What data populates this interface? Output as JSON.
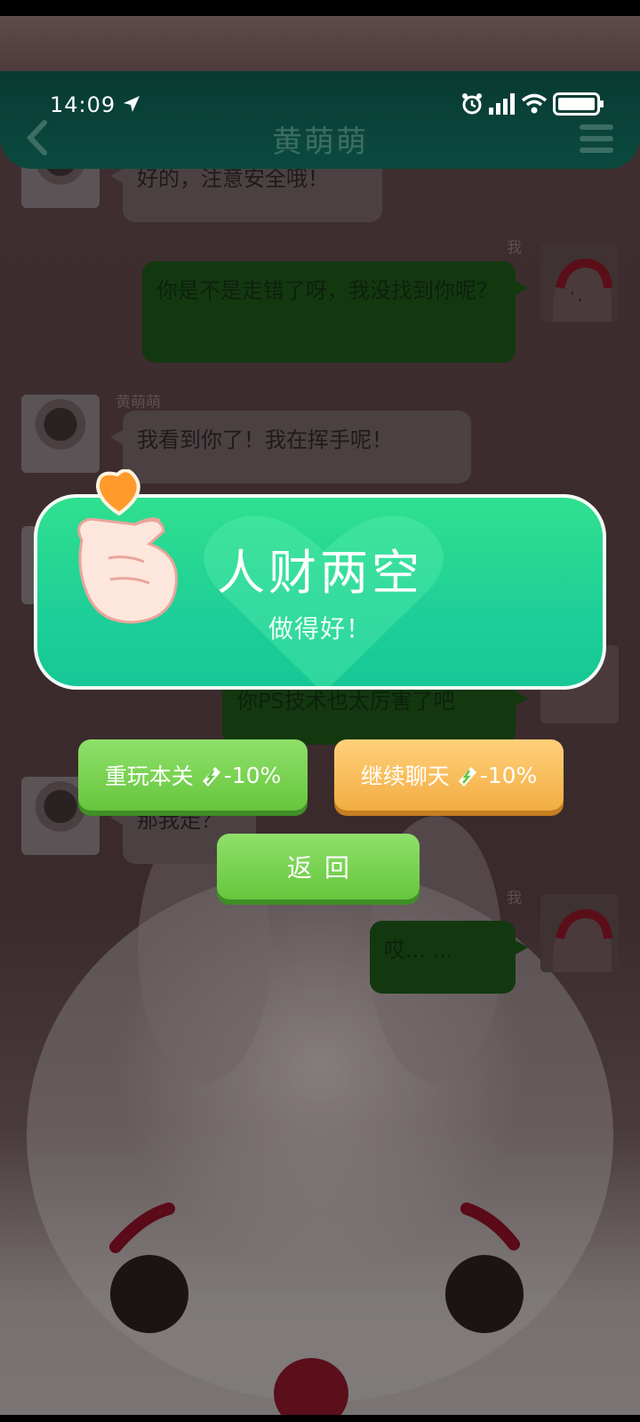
{
  "status_bar": {
    "time": "14:09"
  },
  "header": {
    "title": "黄萌萌"
  },
  "chat": {
    "messages": [
      {
        "side": "left",
        "text": "好的，注意安全哦！"
      },
      {
        "side": "right",
        "sender": "我",
        "text": "你是不是走错了呀，我没找到你呢？"
      },
      {
        "side": "left",
        "sender": "黄萌萌",
        "text": "我看到你了！我在挥手呢！"
      },
      {
        "side": "right",
        "text": "你PS技术也太厉害了吧"
      },
      {
        "side": "left",
        "text": "那我走？"
      },
      {
        "side": "right",
        "sender": "我",
        "text": "哎... ..."
      }
    ]
  },
  "result": {
    "title": "人财两空",
    "subtitle": "做得好！"
  },
  "buttons": {
    "replay": {
      "label": "重玩本关",
      "cost": "-10%"
    },
    "continue": {
      "label": "继续聊天",
      "cost": "-10%"
    },
    "back": {
      "label": "返回"
    }
  },
  "colors": {
    "card_green": "#22d698",
    "replay_green": "#6fcb45",
    "continue_orange": "#f4b247"
  }
}
